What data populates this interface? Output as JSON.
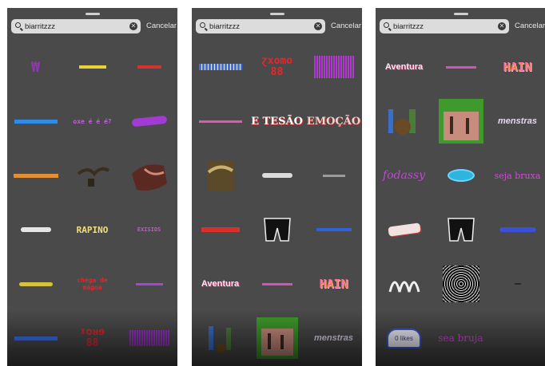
{
  "search": {
    "query": "biarritzzz",
    "cancel_label": "Cancelar"
  },
  "panels": [
    {
      "stickers": [
        {
          "text": "",
          "name": "sticker-purple-glyph"
        },
        {
          "text": "",
          "name": "sticker-yellow-scribble"
        },
        {
          "text": "",
          "name": "sticker-red-scribble"
        },
        {
          "text": "",
          "name": "sticker-blue-text"
        },
        {
          "text": "oxe é é é?",
          "name": "sticker-oxe"
        },
        {
          "text": "",
          "name": "sticker-purple-wavy"
        },
        {
          "text": "",
          "name": "sticker-orange-text"
        },
        {
          "text": "",
          "name": "sticker-bird-art"
        },
        {
          "text": "",
          "name": "sticker-dark-art"
        },
        {
          "text": "",
          "name": "sticker-white-wavy"
        },
        {
          "text": "RAPINO",
          "name": "sticker-rapino"
        },
        {
          "text": "EXISIOS",
          "name": "sticker-exisios"
        },
        {
          "text": "",
          "name": "sticker-yellow-squiggle"
        },
        {
          "text": "chega de mágoa",
          "name": "sticker-chega-de-magoa"
        },
        {
          "text": "",
          "name": "sticker-purple-small"
        },
        {
          "text": "",
          "name": "sticker-blue-pixel"
        },
        {
          "text": "ᵡoᴚɘ 88",
          "name": "sticker-red-88"
        },
        {
          "text": "",
          "name": "sticker-purple-grid"
        }
      ]
    },
    {
      "stickers": [
        {
          "text": "",
          "name": "sticker-blue-pixel"
        },
        {
          "text": "ɀxomo 88",
          "name": "sticker-red-88"
        },
        {
          "text": "",
          "name": "sticker-purple-grid"
        },
        {
          "text": "",
          "name": "sticker-pink-scribble"
        },
        {
          "text": "E TESÃO",
          "name": "sticker-e-tesao"
        },
        {
          "text": "EMOÇÃO",
          "name": "sticker-emocao"
        },
        {
          "text": "",
          "name": "sticker-bird-art"
        },
        {
          "text": "",
          "name": "sticker-white-wavy"
        },
        {
          "text": "",
          "name": "sticker-gray-text"
        },
        {
          "text": "",
          "name": "sticker-red-text"
        },
        {
          "text": "",
          "name": "sticker-shorts-art"
        },
        {
          "text": "",
          "name": "sticker-blue-text"
        },
        {
          "text": "Aventura",
          "name": "sticker-aventura"
        },
        {
          "text": "",
          "name": "sticker-pink-small"
        },
        {
          "text": "HAIN",
          "name": "sticker-hain"
        },
        {
          "text": "",
          "name": "sticker-figures-art"
        },
        {
          "text": "",
          "name": "sticker-photo-art"
        },
        {
          "text": "menstras",
          "name": "sticker-menstras"
        }
      ]
    },
    {
      "stickers": [
        {
          "text": "Aventura",
          "name": "sticker-aventura"
        },
        {
          "text": "",
          "name": "sticker-pink-small"
        },
        {
          "text": "HAIN",
          "name": "sticker-hain"
        },
        {
          "text": "",
          "name": "sticker-figures-art"
        },
        {
          "text": "",
          "name": "sticker-photo-art"
        },
        {
          "text": "menstras",
          "name": "sticker-menstras"
        },
        {
          "text": "fodassy",
          "name": "sticker-fodassy"
        },
        {
          "text": "",
          "name": "sticker-blue-oval"
        },
        {
          "text": "seja bruxa",
          "name": "sticker-seja-bruxa"
        },
        {
          "text": "",
          "name": "sticker-wdt"
        },
        {
          "text": "",
          "name": "sticker-shorts-art"
        },
        {
          "text": "",
          "name": "sticker-blue-text"
        },
        {
          "text": "",
          "name": "sticker-white-glyph"
        },
        {
          "text": "",
          "name": "sticker-pattern-art"
        },
        {
          "text": "",
          "name": "sticker-tiny-mark"
        },
        {
          "text": "0 likes",
          "name": "sticker-0-likes"
        },
        {
          "text": "sea bruja",
          "name": "sticker-sea-bruja"
        },
        {
          "text": "",
          "name": "sticker-empty"
        }
      ]
    }
  ],
  "colors": {
    "panel_bg": "#4a4a4a",
    "search_bg": "#dcdcdc",
    "purple": "#b338c9",
    "red": "#e0282c",
    "yellow": "#f2d43a",
    "blue": "#3a8cff"
  }
}
